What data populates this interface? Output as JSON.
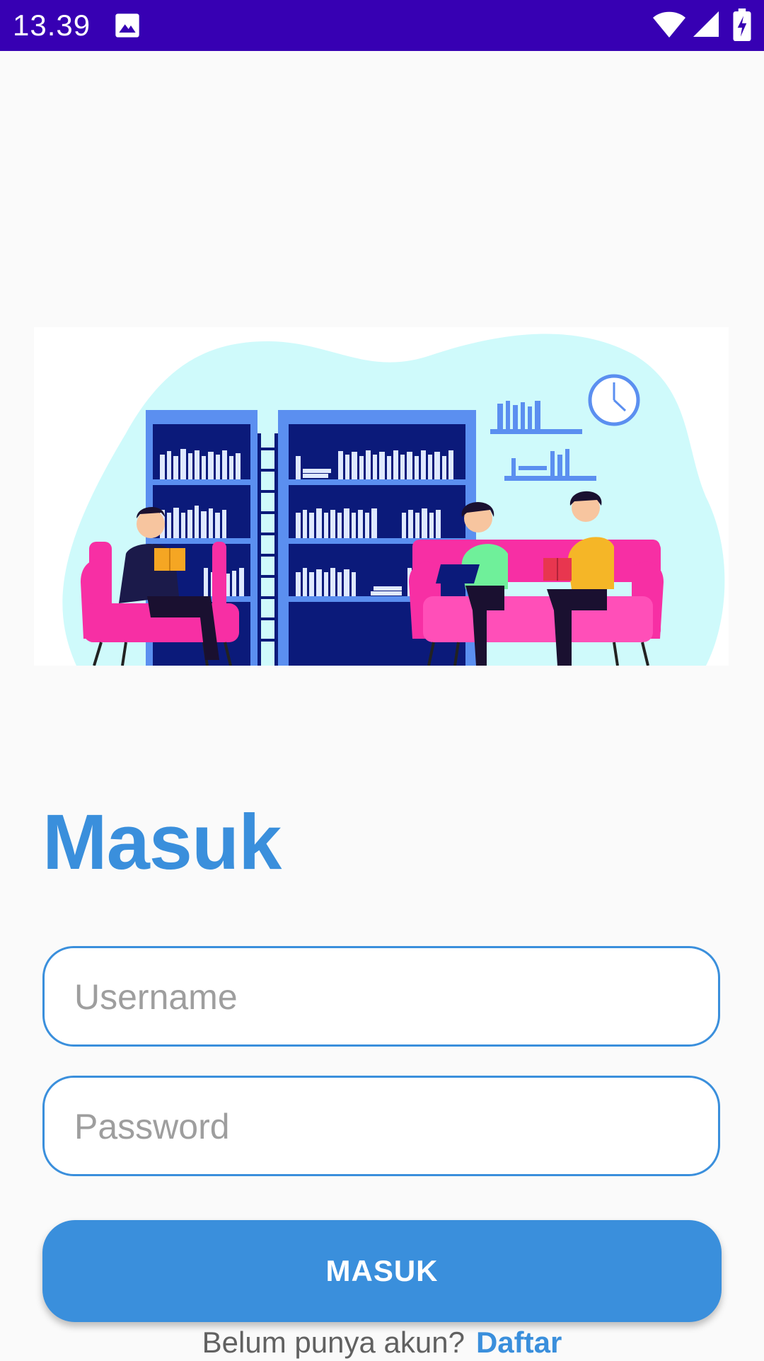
{
  "status_bar": {
    "time": "13.39",
    "icons": [
      "gallery-icon",
      "wifi-icon",
      "signal-icon",
      "battery-charging-icon"
    ],
    "background": "#3700b3"
  },
  "illustration": {
    "description_icon": "library-reading-illustration"
  },
  "login": {
    "title": "Masuk",
    "username_placeholder": "Username",
    "username_value": "",
    "password_placeholder": "Password",
    "password_value": "",
    "submit_label": "MASUK",
    "register_prompt": "Belum punya akun?",
    "register_link": "Daftar"
  },
  "colors": {
    "accent": "#3a8fdc",
    "background": "#fafafa",
    "placeholder": "#9e9e9e"
  }
}
